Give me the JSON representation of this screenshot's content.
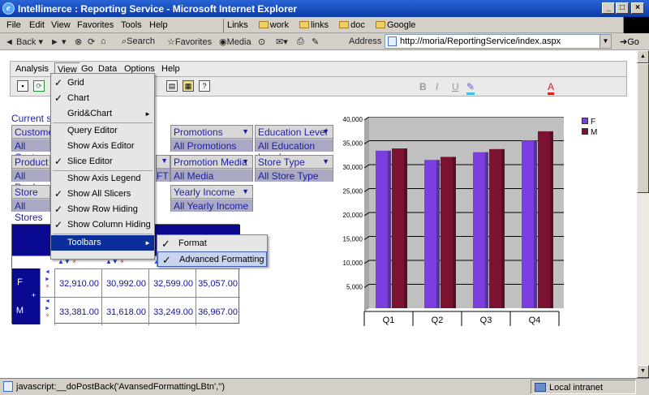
{
  "window": {
    "title": "Intellimerce : Reporting Service - Microsoft Internet Explorer"
  },
  "browser_menu": [
    "File",
    "Edit",
    "View",
    "Favorites",
    "Tools",
    "Help"
  ],
  "links": {
    "label": "Links",
    "items": [
      "work",
      "links",
      "doc",
      "Google"
    ]
  },
  "toolbar": {
    "back": "Back",
    "search": "Search",
    "favorites": "Favorites",
    "media": "Media",
    "address_label": "Address",
    "url": "http://moria/ReportingService/index.aspx",
    "go": "Go"
  },
  "app_menu": [
    "Analysis",
    "View",
    "Go",
    "Data",
    "Options",
    "Help"
  ],
  "format_buttons": [
    "B",
    "I",
    "U",
    "A"
  ],
  "current_slicers_label": "Current sli",
  "slicers": [
    {
      "title": "Custome",
      "value": "All Custo"
    },
    {
      "title": "Promotions",
      "value": "All Promotions"
    },
    {
      "title": "Education Level",
      "value": "All Education Level"
    },
    {
      "title": "Product",
      "value": "All Produ"
    },
    {
      "title": "Promotion Media",
      "value": "All Media"
    },
    {
      "title": "Store Type",
      "value": "All Store Type"
    },
    {
      "title": "Store",
      "value": "All Stores"
    },
    {
      "title": "Yearly Income",
      "value": "All Yearly Income"
    }
  ],
  "fragment_ft": "FT",
  "view_menu": {
    "items": [
      {
        "label": "Grid",
        "checked": true
      },
      {
        "label": "Chart",
        "checked": true
      },
      {
        "label": "Grid&Chart",
        "checked": false
      },
      {
        "label": "Query Editor",
        "checked": false
      },
      {
        "label": "Show Axis Editor",
        "checked": false
      },
      {
        "label": "Slice Editor",
        "checked": true
      },
      {
        "label": "Show Axis Legend",
        "checked": false
      },
      {
        "label": "Show All Slicers",
        "checked": true
      },
      {
        "label": "Show Row Hiding",
        "checked": true
      },
      {
        "label": "Show Column Hiding",
        "checked": true
      },
      {
        "label": "Toolbars",
        "checked": false
      }
    ]
  },
  "toolbars_submenu": [
    {
      "label": "Format",
      "checked": true
    },
    {
      "label": "Advanced Formatting",
      "checked": true
    }
  ],
  "grid": {
    "rows": [
      {
        "label": "F",
        "values": [
          "32,910.00",
          "30,992.00",
          "32,599.00",
          "35,057.00"
        ]
      },
      {
        "label": "M",
        "values": [
          "33,381.00",
          "31,618.00",
          "33,249.00",
          "36,967.00"
        ]
      }
    ]
  },
  "chart_data": {
    "type": "bar",
    "categories": [
      "Q1",
      "Q2",
      "Q3",
      "Q4"
    ],
    "series": [
      {
        "name": "F",
        "values": [
          32910,
          30992,
          32599,
          35057
        ],
        "color": "#7b3fe0"
      },
      {
        "name": "M",
        "values": [
          33381,
          31618,
          33249,
          36967
        ],
        "color": "#7a1230"
      }
    ],
    "ylim": [
      0,
      40000
    ],
    "yticks": [
      "5,000",
      "10,000",
      "15,000",
      "20,000",
      "25,000",
      "30,000",
      "35,000",
      "40,000"
    ],
    "legend": "top-right",
    "grid": true
  },
  "status": {
    "text": "javascript:__doPostBack('AvansedFormattingLBtn','')",
    "zone": "Local intranet"
  }
}
